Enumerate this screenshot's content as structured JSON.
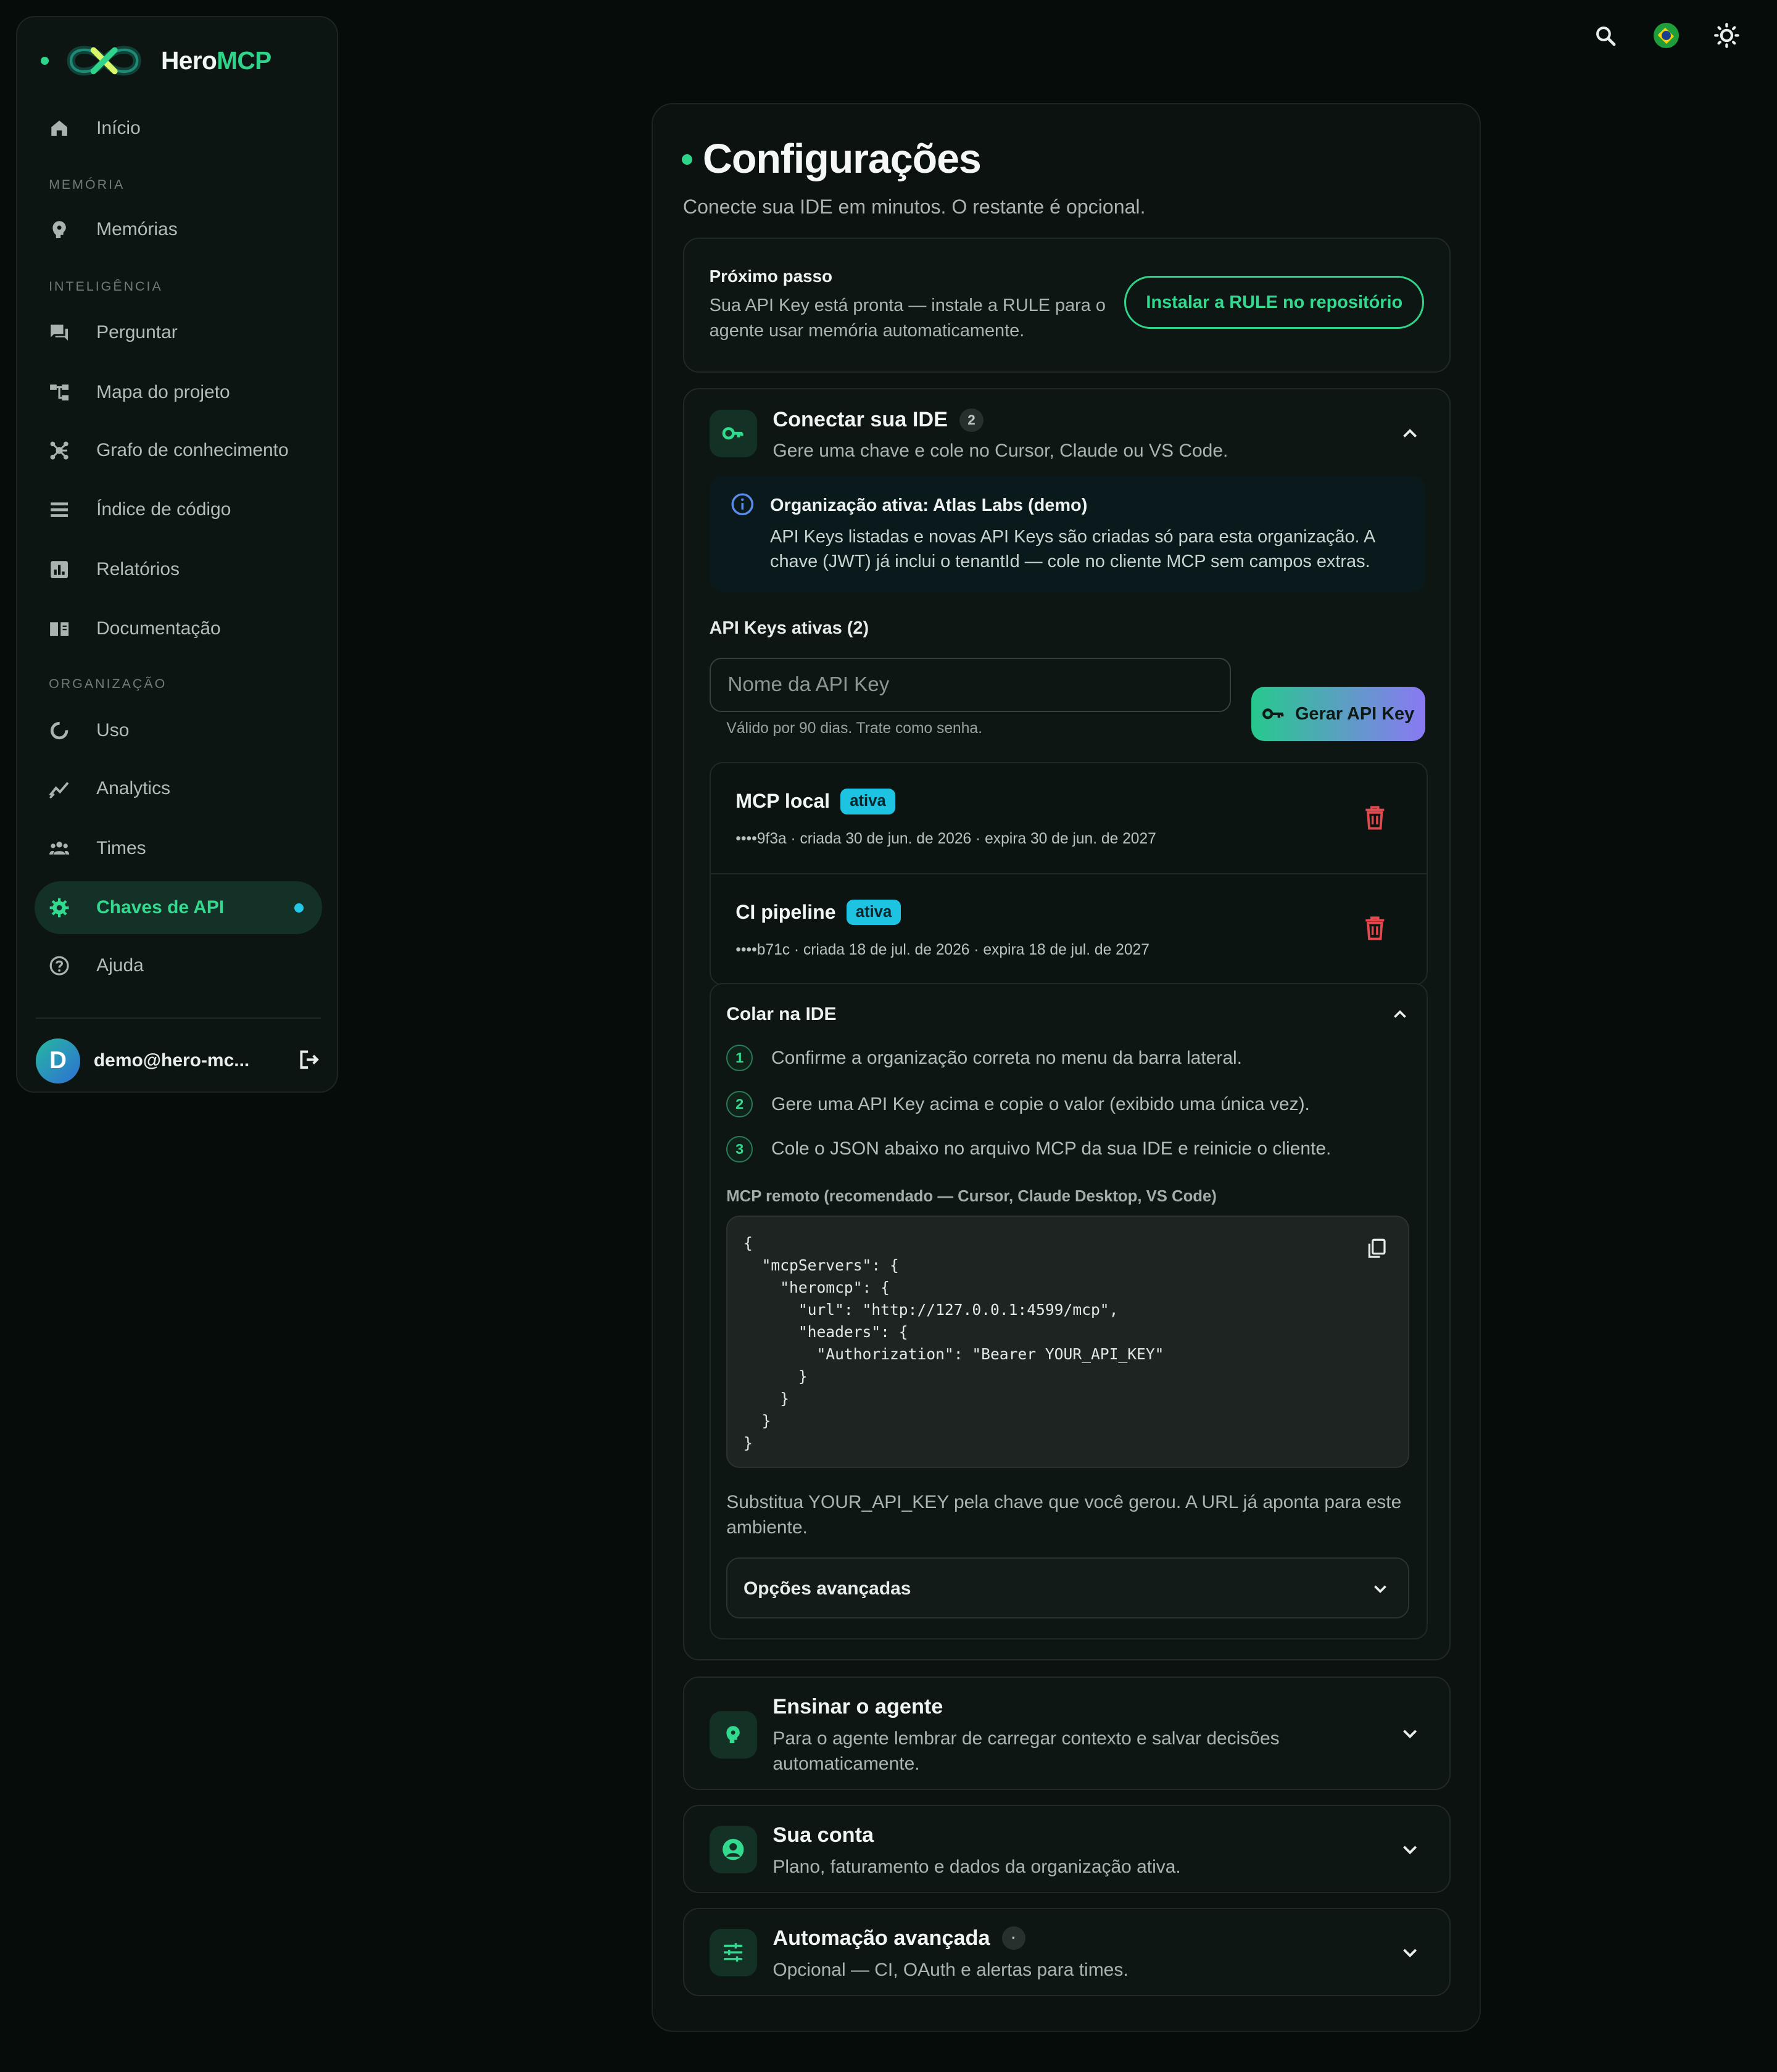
{
  "brand": {
    "name_prefix": "Hero",
    "name_accent": "MCP"
  },
  "sidebar": {
    "items": [
      {
        "label": "Início",
        "icon": "home-icon"
      },
      {
        "label": "Memórias",
        "icon": "brain-icon"
      },
      {
        "label": "Perguntar",
        "icon": "chat-icon"
      },
      {
        "label": "Mapa do projeto",
        "icon": "tree-icon"
      },
      {
        "label": "Grafo de conhecimento",
        "icon": "graph-icon"
      },
      {
        "label": "Índice de código",
        "icon": "list-icon"
      },
      {
        "label": "Relatórios",
        "icon": "chart-icon"
      },
      {
        "label": "Documentação",
        "icon": "book-icon"
      },
      {
        "label": "Uso",
        "icon": "donut-icon"
      },
      {
        "label": "Analytics",
        "icon": "trend-icon"
      },
      {
        "label": "Times",
        "icon": "people-icon"
      },
      {
        "label": "Chaves de API",
        "icon": "gear-icon",
        "active": true
      },
      {
        "label": "Ajuda",
        "icon": "help-icon"
      }
    ],
    "sections": {
      "memory": "MEMÓRIA",
      "intelligence": "INTELIGÊNCIA",
      "organization": "ORGANIZAÇÃO"
    },
    "user": {
      "initial": "D",
      "email": "demo@hero-mc..."
    }
  },
  "main": {
    "title": "Configurações",
    "subtitle": "Conecte sua IDE em minutos. O restante é opcional.",
    "next_step": {
      "title": "Próximo passo",
      "text": "Sua API Key está pronta — instale a RULE para o agente usar memória automaticamente.",
      "button": "Instalar a RULE no repositório"
    },
    "connect": {
      "title": "Conectar sua IDE",
      "badge": "2",
      "desc": "Gere uma chave e cole no Cursor, Claude ou VS Code.",
      "info_title": "Organização ativa: Atlas Labs (demo)",
      "info_text": "API Keys listadas e novas API Keys são criadas só para esta organização. A chave (JWT) já inclui o tenantId — cole no cliente MCP sem campos extras.",
      "keys_label": "API Keys ativas (2)",
      "input_placeholder": "Nome da API Key",
      "input_hint": "Válido por 90 dias. Trate como senha.",
      "generate_button": "Gerar API Key",
      "keys": [
        {
          "name": "MCP local",
          "status": "ativa",
          "meta": "••••9f3a · criada 30 de jun. de 2026 · expira 30 de jun. de 2027"
        },
        {
          "name": "CI pipeline",
          "status": "ativa",
          "meta": "••••b71c · criada 18 de jul. de 2026 · expira 18 de jul. de 2027"
        }
      ],
      "paste": {
        "title": "Colar na IDE",
        "steps": [
          "Confirme a organização correta no menu da barra lateral.",
          "Gere uma API Key acima e copie o valor (exibido uma única vez).",
          "Cole o JSON abaixo no arquivo MCP da sua IDE e reinicie o cliente."
        ],
        "code_label": "MCP remoto (recomendado — Cursor, Claude Desktop, VS Code)",
        "code": "{\n  \"mcpServers\": {\n    \"heromcp\": {\n      \"url\": \"http://127.0.0.1:4599/mcp\",\n      \"headers\": {\n        \"Authorization\": \"Bearer YOUR_API_KEY\"\n      }\n    }\n  }\n}",
        "substitute": "Substitua YOUR_API_KEY pela chave que você gerou. A URL já aponta para este ambiente.",
        "advanced": "Opções avançadas"
      }
    },
    "teach": {
      "title": "Ensinar o agente",
      "desc": "Para o agente lembrar de carregar contexto e salvar decisões automaticamente."
    },
    "account": {
      "title": "Sua conta",
      "desc": "Plano, faturamento e dados da organização ativa."
    },
    "automation": {
      "title": "Automação avançada",
      "badge": "·",
      "desc": "Opcional — CI, OAuth e alertas para times."
    }
  },
  "colors": {
    "accent": "#2fd38a",
    "status": "#1dc3e0",
    "danger": "#e5484d",
    "background": "#060c0a"
  }
}
